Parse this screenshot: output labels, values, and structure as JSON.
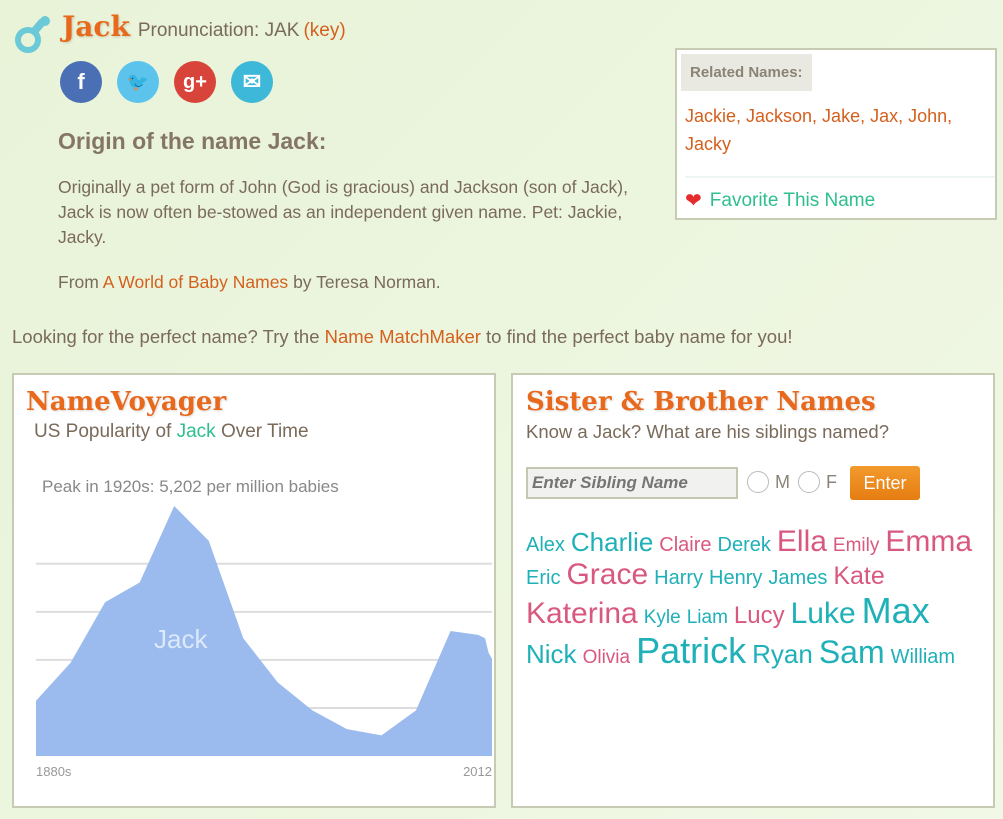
{
  "header": {
    "name": "Jack",
    "pronunciation_label": "Pronunciation: JAK",
    "key_link": "(key)"
  },
  "social": [
    {
      "icon": "facebook-icon",
      "glyph": "f",
      "color": "#4a6fb5"
    },
    {
      "icon": "twitter-icon",
      "glyph": "🐦",
      "color": "#5cc3ed"
    },
    {
      "icon": "google-plus-icon",
      "glyph": "g+",
      "color": "#d8443a"
    },
    {
      "icon": "email-icon",
      "glyph": "✉",
      "color": "#3db8d8"
    }
  ],
  "origin": {
    "title": "Origin of the name Jack:",
    "text": "Originally a pet form of John (God is gracious) and Jackson (son of Jack), Jack is now often be-stowed as an independent given name. Pet: Jackie, Jacky.",
    "from_prefix": "From",
    "book": "A World of Baby Names",
    "from_suffix": "by Teresa Norman."
  },
  "related": {
    "label": "Related Names:",
    "names": "Jackie, Jackson, Jake, Jax, John, Jacky",
    "favorite": "Favorite This Name"
  },
  "matchmaker": {
    "prefix": "Looking for the perfect name? Try the",
    "link": "Name MatchMaker",
    "suffix": "to find the perfect baby name for you!"
  },
  "voyager": {
    "title": "NameVoyager",
    "subtitle_prefix": "US Popularity of",
    "subtitle_name": "Jack",
    "subtitle_suffix": "Over Time"
  },
  "chart_data": {
    "type": "area",
    "annotation": "Peak in 1920s: 5,202 per million babies",
    "series_label": "Jack",
    "x_tick_labels": [
      "1880s",
      "2012"
    ],
    "xlim": [
      1880,
      2012
    ],
    "ylim": [
      0,
      5202
    ],
    "grid": true,
    "color": "#9bbbee",
    "x": [
      1880,
      1890,
      1900,
      1910,
      1920,
      1930,
      1940,
      1950,
      1960,
      1970,
      1980,
      1990,
      2000,
      2008,
      2010,
      2011,
      2012
    ],
    "y": [
      1150,
      1940,
      3200,
      3610,
      5202,
      4480,
      2450,
      1530,
      950,
      560,
      430,
      950,
      2600,
      2520,
      2450,
      2150,
      2020
    ]
  },
  "siblings": {
    "title": "Sister & Brother Names",
    "subtitle": "Know a Jack? What are his siblings named?",
    "input_placeholder": "Enter Sibling Name",
    "male": "M",
    "female": "F",
    "enter": "Enter",
    "names": [
      {
        "n": "Alex",
        "g": "boy",
        "s": 20
      },
      {
        "n": "Charlie",
        "g": "boy",
        "s": 26
      },
      {
        "n": "Claire",
        "g": "girl",
        "s": 20
      },
      {
        "n": "Derek",
        "g": "boy",
        "s": 20
      },
      {
        "n": "Ella",
        "g": "girl",
        "s": 30
      },
      {
        "n": "Emily",
        "g": "girl",
        "s": 19
      },
      {
        "n": "Emma",
        "g": "girl",
        "s": 30
      },
      {
        "n": "Eric",
        "g": "boy",
        "s": 20
      },
      {
        "n": "Grace",
        "g": "girl",
        "s": 30
      },
      {
        "n": "Harry",
        "g": "boy",
        "s": 20
      },
      {
        "n": "Henry",
        "g": "boy",
        "s": 20
      },
      {
        "n": "James",
        "g": "boy",
        "s": 20
      },
      {
        "n": "Kate",
        "g": "girl",
        "s": 25
      },
      {
        "n": "Katerina",
        "g": "girl",
        "s": 30
      },
      {
        "n": "Kyle",
        "g": "boy",
        "s": 19
      },
      {
        "n": "Liam",
        "g": "boy",
        "s": 19
      },
      {
        "n": "Lucy",
        "g": "girl",
        "s": 24
      },
      {
        "n": "Luke",
        "g": "boy",
        "s": 30
      },
      {
        "n": "Max",
        "g": "boy",
        "s": 36
      },
      {
        "n": "Nick",
        "g": "boy",
        "s": 26
      },
      {
        "n": "Olivia",
        "g": "girl",
        "s": 19
      },
      {
        "n": "Patrick",
        "g": "boy",
        "s": 36
      },
      {
        "n": "Ryan",
        "g": "boy",
        "s": 26
      },
      {
        "n": "Sam",
        "g": "boy",
        "s": 32
      },
      {
        "n": "William",
        "g": "boy",
        "s": 20
      }
    ]
  }
}
